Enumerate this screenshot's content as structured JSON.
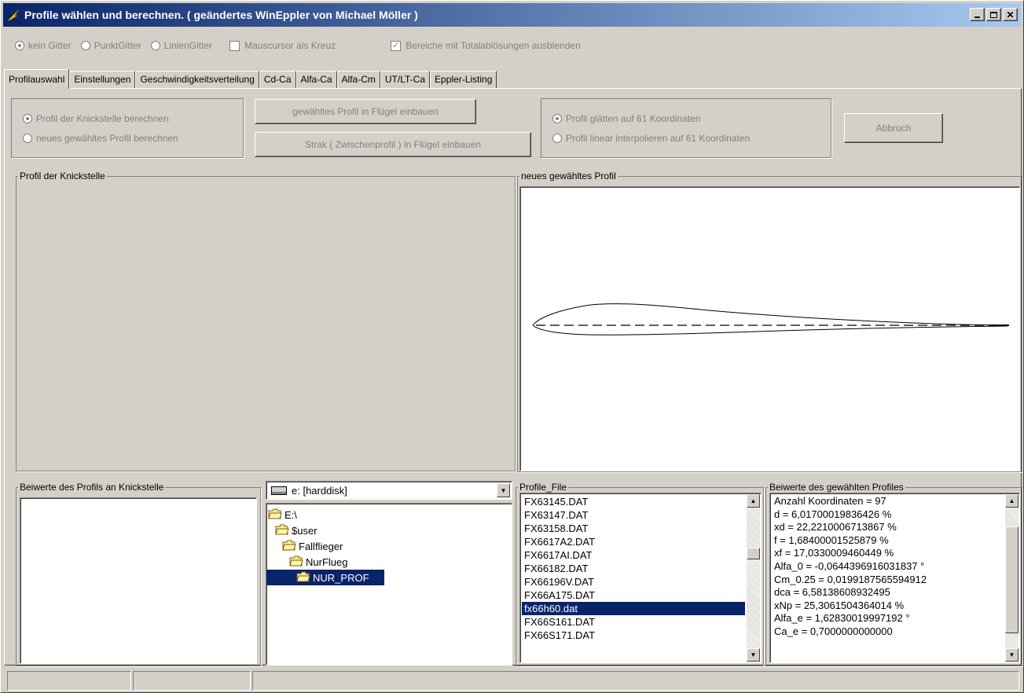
{
  "window": {
    "title": "Profile wählen und berechnen. ( geändertes WinEppler von Michael Möller )",
    "buttons": [
      "_",
      "□",
      "X"
    ]
  },
  "options": {
    "grid_radios": [
      {
        "label": "kein Gitter",
        "selected": true
      },
      {
        "label": "PunktGitter",
        "selected": false
      },
      {
        "label": "LinienGitter",
        "selected": false
      }
    ],
    "checkboxes": [
      {
        "label": "Mauscursor als Kreuz",
        "checked": false
      },
      {
        "label": "Bereiche mit Totalablösungen ausblenden",
        "checked": true
      }
    ]
  },
  "tabs": [
    "Profilauswahl",
    "Einstellungen",
    "Geschwindigkeitsverteilung",
    "Cd-Ca",
    "Alfa-Ca",
    "Alfa-Cm",
    "UT/LT-Ca",
    "Eppler-Listing"
  ],
  "active_tab": "Profilauswahl",
  "calc_options": [
    {
      "label": "Profil der Knickstelle berechnen",
      "selected": true
    },
    {
      "label": "neues gewähltes Profil berechnen",
      "selected": false
    }
  ],
  "actions": {
    "insert_profile": "gewähltes Profil in Flügel einbauen",
    "insert_strak": "Strak ( Zwischenprofil ) in Flügel einbauen",
    "cancel": "Abbruch"
  },
  "smooth_options": [
    {
      "label": "Profil glätten auf 61 Koordinaten",
      "selected": true
    },
    {
      "label": "Profil linear interpolieren auf 61 Koordinaten",
      "selected": false
    }
  ],
  "panels": {
    "kink_profile": "Profil der Knickstelle",
    "new_profile": "neues gewähltes Profil",
    "kink_coeffs": "Beiwerte des Profils an Knickstelle",
    "profile_file": "Profile_File",
    "selected_coeffs": "Beiwerte des gewählten Profiles"
  },
  "drive": {
    "selected": "e: [harddisk]"
  },
  "directories": [
    {
      "name": "E:\\",
      "level": 0,
      "selected": false
    },
    {
      "name": "$user",
      "level": 1,
      "selected": false
    },
    {
      "name": "Fallflieger",
      "level": 2,
      "selected": false
    },
    {
      "name": "NurFlueg",
      "level": 3,
      "selected": false
    },
    {
      "name": "NUR_PROF",
      "level": 4,
      "selected": true
    }
  ],
  "files": [
    {
      "name": "FX63145.DAT",
      "selected": false
    },
    {
      "name": "FX63147.DAT",
      "selected": false
    },
    {
      "name": "FX63158.DAT",
      "selected": false
    },
    {
      "name": "FX6617A2.DAT",
      "selected": false
    },
    {
      "name": "FX6617AI.DAT",
      "selected": false
    },
    {
      "name": "FX66182.DAT",
      "selected": false
    },
    {
      "name": "FX66196V.DAT",
      "selected": false
    },
    {
      "name": "FX66A175.DAT",
      "selected": false
    },
    {
      "name": "fx66h60.dat",
      "selected": true
    },
    {
      "name": "FX66S161.DAT",
      "selected": false
    },
    {
      "name": "FX66S171.DAT",
      "selected": false
    }
  ],
  "coefficients": [
    "Anzahl Koordinaten = 97",
    "d = 6,01700019836426 %",
    "xd = 22,2210006713867 %",
    "f = 1,68400001525879 %",
    "xf = 17,0330009460449 %",
    "Alfa_0 = -0,0644396916031837 °",
    "Cm_0.25 = 0,0199187565594912",
    "dca = 6,58138608932495",
    "xNp = 25,3061504364014 %",
    "Alfa_e = 1,62830019997192 °",
    "Ca_e = 0,7000000000000"
  ],
  "colors": {
    "face": "#d4d0c8",
    "title_start": "#0a246a",
    "title_end": "#a6caf0",
    "selection": "#0a246a"
  }
}
